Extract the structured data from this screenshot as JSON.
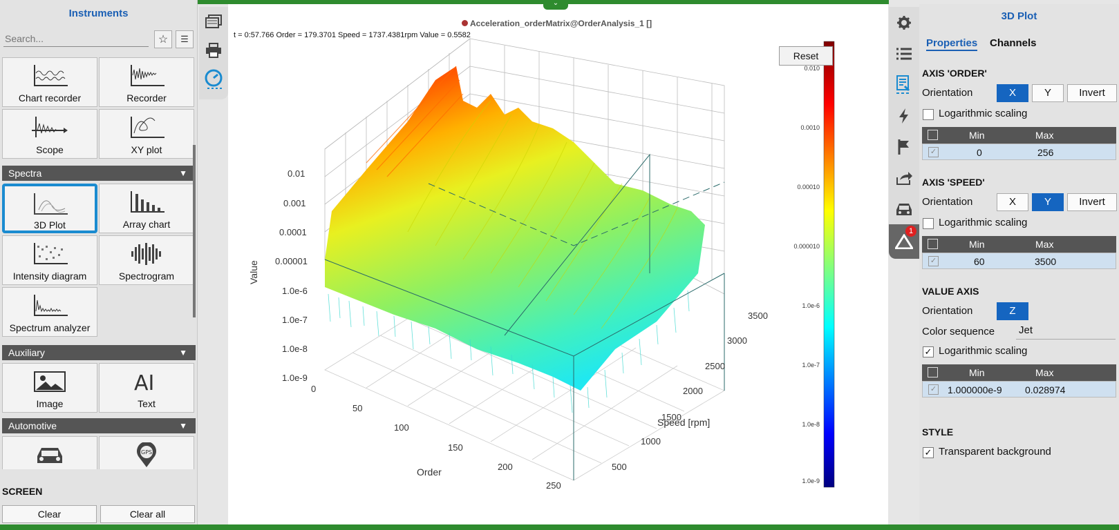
{
  "left_panel": {
    "title": "Instruments",
    "search_placeholder": "Search...",
    "tiles_top": [
      {
        "label": "Chart recorder",
        "icon": "chart-recorder-icon"
      },
      {
        "label": "Recorder",
        "icon": "recorder-icon"
      },
      {
        "label": "Scope",
        "icon": "scope-icon"
      },
      {
        "label": "XY plot",
        "icon": "xy-plot-icon"
      }
    ],
    "cat_spectra": "Spectra",
    "tiles_spectra": [
      {
        "label": "3D Plot",
        "icon": "3d-plot-icon"
      },
      {
        "label": "Array chart",
        "icon": "array-chart-icon"
      },
      {
        "label": "Intensity diagram",
        "icon": "intensity-diagram-icon"
      },
      {
        "label": "Spectrogram",
        "icon": "spectrogram-icon"
      },
      {
        "label": "Spectrum analyzer",
        "icon": "spectrum-analyzer-icon"
      }
    ],
    "cat_auxiliary": "Auxiliary",
    "tiles_aux": [
      {
        "label": "Image",
        "icon": "image-icon"
      },
      {
        "label": "Text",
        "icon": "text-icon"
      }
    ],
    "cat_automotive": "Automotive",
    "screen_label": "SCREEN",
    "clear_label": "Clear",
    "clear_all_label": "Clear all"
  },
  "chart": {
    "title": "Acceleration_orderMatrix@OrderAnalysis_1 []",
    "readout": "t = 0:57.766  Order = 179.3701  Speed = 1737.4381rpm  Value = 0.5582",
    "reset_label": "Reset"
  },
  "chart_data": {
    "type": "surface3d",
    "title": "Acceleration_orderMatrix@OrderAnalysis_1 []",
    "xlabel": "Order",
    "ylabel": "Speed [rpm]",
    "zlabel": "Value",
    "x_ticks": [
      "0",
      "50",
      "100",
      "150",
      "200",
      "250"
    ],
    "y_ticks": [
      "500",
      "1000",
      "1500",
      "2000",
      "2500",
      "3000",
      "3500"
    ],
    "z_ticks": [
      "0.01",
      "0.001",
      "0.0001",
      "0.00001",
      "1.0e-6",
      "1.0e-7",
      "1.0e-8",
      "1.0e-9"
    ],
    "z_scale": "log",
    "colormap": "jet",
    "colorbar_ticks": [
      "0.010",
      "0.0010",
      "0.00010",
      "0.000010",
      "1.0e-6",
      "1.0e-7",
      "1.0e-8",
      "1.0e-9"
    ]
  },
  "right_panel": {
    "title": "3D Plot",
    "tab_properties": "Properties",
    "tab_channels": "Channels",
    "axis_order": "AXIS 'ORDER'",
    "axis_speed": "AXIS 'SPEED'",
    "value_axis": "VALUE AXIS",
    "orientation": "Orientation",
    "btn_x": "X",
    "btn_y": "Y",
    "btn_z": "Z",
    "btn_invert": "Invert",
    "log_scaling": "Logarithmic scaling",
    "min": "Min",
    "max": "Max",
    "order_min": "0",
    "order_max": "256",
    "speed_min": "60",
    "speed_max": "3500",
    "value_min": "1.000000e-9",
    "value_max": "0.028974",
    "color_sequence_label": "Color sequence",
    "color_sequence": "Jet",
    "style": "STYLE",
    "transparent_bg": "Transparent background",
    "badge_count": "1"
  }
}
